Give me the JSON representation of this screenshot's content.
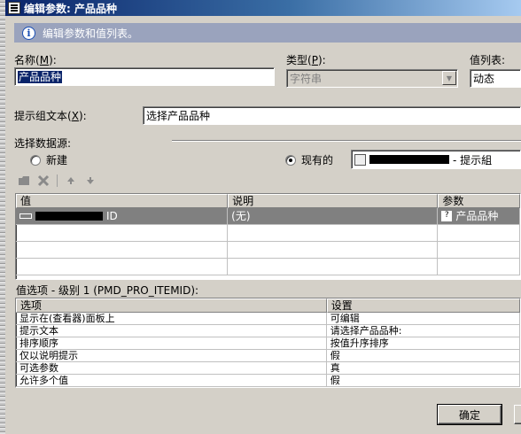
{
  "window": {
    "title": "编辑参数: 产品品种"
  },
  "info_banner": {
    "text": "编辑参数和值列表。"
  },
  "name_field": {
    "label": "名称",
    "accel": "M",
    "value": "产品品种"
  },
  "type_field": {
    "label": "类型",
    "accel": "P",
    "value": "字符串"
  },
  "value_list": {
    "label": "值列表:",
    "value": "动态"
  },
  "prompt_text": {
    "label": "提示组文本",
    "accel": "X",
    "value": "选择产品品种"
  },
  "datasource": {
    "label": "选择数据源:",
    "option_new": "新建",
    "option_existing": "现有的",
    "existing_value_suffix": "- 提示組"
  },
  "values_table": {
    "columns": [
      "值",
      "说明",
      "参数"
    ],
    "rows": [
      {
        "value_suffix": "ID",
        "description": "(无)",
        "param": "产品品种"
      }
    ]
  },
  "value_options": {
    "label": "值选项 - 级别 1 (PMD_PRO_ITEMID):",
    "columns": [
      "选项",
      "设置"
    ],
    "rows": [
      {
        "option": "显示在(查看器)面板上",
        "setting": "可编辑"
      },
      {
        "option": "提示文本",
        "setting": "请选择产品品种:"
      },
      {
        "option": "排序顺序",
        "setting": "按值升序排序"
      },
      {
        "option": "仅以说明提示",
        "setting": "假"
      },
      {
        "option": "可选参数",
        "setting": "真"
      },
      {
        "option": "允许多个值",
        "setting": "假"
      }
    ]
  },
  "buttons": {
    "ok": "确定"
  }
}
